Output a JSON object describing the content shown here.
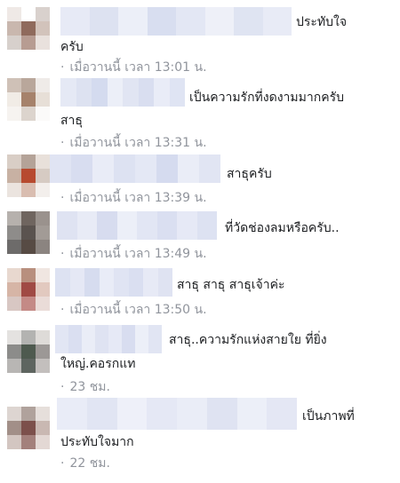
{
  "comments": [
    {
      "line1": "ประทับใจ",
      "line2": "ครับ",
      "time": "เมื่อวานนี้ เวลา 13:01 น.",
      "avatar": [
        "#efe9e6",
        "#ffffff",
        "#d9d1cd",
        "#c9b7ae",
        "#8f6a5c",
        "#d2c3bb",
        "#d7d0cc",
        "#b79c92",
        "#e9e1dd"
      ],
      "blur": [
        "#e7eaf6",
        "#dde2f1",
        "#eceff8",
        "#d8def0",
        "#e3e7f4",
        "#eef0f8",
        "#dfe4f2",
        "#e8ebf6"
      ]
    },
    {
      "line1": "เป็นความรักที่งดงามมากครับ",
      "line2": "สาธุ",
      "time": "เมื่อวานนี้ เวลา 13:31 น.",
      "avatar": [
        "#cfc1b7",
        "#b9a79b",
        "#efebe8",
        "#f1ece6",
        "#a6826b",
        "#e7dfd7",
        "#f6f3f0",
        "#dcd4cd",
        "#fbfaf9"
      ],
      "blur": [
        "#e5e9f5",
        "#dde2f1",
        "#d4dbef",
        "#eceff8",
        "#e1e5f3",
        "#d9def0",
        "#e9ecf7",
        "#dfe4f3"
      ]
    },
    {
      "line1": "สาธุครับ",
      "line2": "",
      "time": "เมื่อวานนี้ เวลา 13:39 น.",
      "avatar": [
        "#d9cec6",
        "#b4a398",
        "#e8e0da",
        "#c8b1a3",
        "#b74a2f",
        "#d6cbc3",
        "#ebe4df",
        "#d9bdb0",
        "#f3efec"
      ],
      "blur": [
        "#e0e4f3",
        "#d8ddf0",
        "#e9ecf7",
        "#dde2f2",
        "#e4e8f5",
        "#d5dbef",
        "#eaedf7",
        "#e1e5f3"
      ]
    },
    {
      "line1": "ที่วัดช่องลมหรือครับ..",
      "line2": "",
      "time": "เมื่อวานนี้ เวลา 13:49 น.",
      "avatar": [
        "#b6b1ad",
        "#6f655f",
        "#9a928d",
        "#8e8c8a",
        "#5a534f",
        "#a29b96",
        "#6d6b6a",
        "#574b44",
        "#8b8480"
      ],
      "blur": [
        "#dfe3f2",
        "#e8ebf6",
        "#d7dcef",
        "#eceff8",
        "#e2e6f4",
        "#dadff1",
        "#e6e9f6",
        "#dde2f2"
      ]
    },
    {
      "line1": "สาธุ สาธุ สาธุเจ้าค่ะ",
      "line2": "",
      "time": "เมื่อวานนี้ เวลา 13:50 น.",
      "avatar": [
        "#e8d8cf",
        "#b88f7e",
        "#f0e6e1",
        "#d6b5a6",
        "#a04a44",
        "#e2c9bf",
        "#d8c7c3",
        "#c48a86",
        "#eadcd8"
      ],
      "blur": [
        "#dde2f2",
        "#e5e8f5",
        "#d6dcef",
        "#e9ecf7",
        "#e0e4f3",
        "#dadff1",
        "#e7eaf6",
        "#dfe3f2"
      ]
    },
    {
      "line1": "สาธุ..ความรักแห่งสายใย ที่ยิ่ง",
      "line2": "ใหญ่.คอรกแท",
      "time": "23 ชม.",
      "avatar": [
        "#e4e2e0",
        "#b3b3b1",
        "#dedbd8",
        "#8c8c8a",
        "#4e5a4f",
        "#9c9896",
        "#b8b6b4",
        "#5e6560",
        "#c3bfbd"
      ],
      "blur": [
        "#e2e6f4",
        "#dadff1",
        "#eaedf7",
        "#dfe3f2",
        "#e6e9f6",
        "#d8ddf0",
        "#eceff8",
        "#e1e5f3"
      ]
    },
    {
      "line1": "เป็นภาพที่",
      "line2": "ประทับใจมาก",
      "time": "22 ชม.",
      "avatar": [
        "#ddd5d1",
        "#b0a29c",
        "#e6dfdb",
        "#a28f88",
        "#7c504b",
        "#c9b8b2",
        "#d3c6c1",
        "#a3807b",
        "#e3d8d4"
      ],
      "blur": [
        "#e9ecf7",
        "#e1e5f3",
        "#eef0f9",
        "#e5e8f5",
        "#eaedf7",
        "#dfe3f2",
        "#eceff8",
        "#e4e7f4"
      ]
    }
  ]
}
